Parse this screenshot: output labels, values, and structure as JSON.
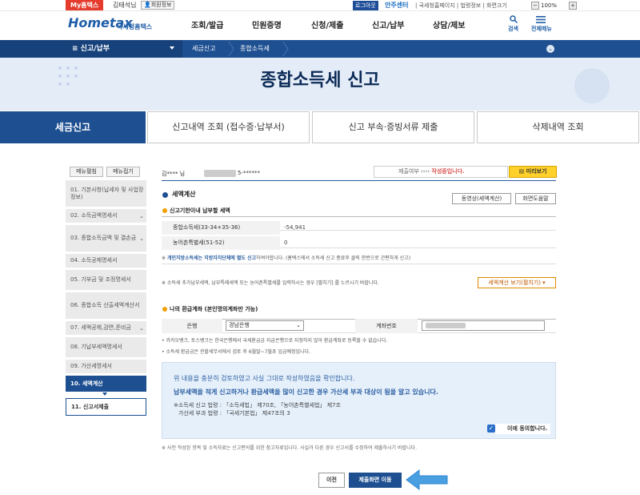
{
  "topbar": {
    "my_hometax": "My홈택스",
    "user_name": "김태석님",
    "user_info": "회원정보",
    "logout": "로그아웃",
    "safe_center": "안주센터",
    "links": "| 국세청홈페이지 | 법령정보 | 화면크기",
    "zoom_minus": "−",
    "zoom": "100%",
    "zoom_plus": "+"
  },
  "header": {
    "logo": "Hometax",
    "logo_sub": "국세청홈택스",
    "gnb": [
      "조회/발급",
      "민원증명",
      "신청/제출",
      "신고/납부",
      "상담/제보"
    ],
    "search": "검색",
    "all_menu": "전체메뉴"
  },
  "nav": {
    "title": "≡  신고/납부",
    "breadcrumb": [
      "세금신고",
      "종합소득세"
    ]
  },
  "banner": {
    "title": "종합소득세 신고"
  },
  "tabs": [
    "세금신고",
    "신고내역 조회 (접수증·납부서)",
    "신고 부속·증빙서류 제출",
    "삭제내역 조회"
  ],
  "sidebar": {
    "expand": "메뉴펼침",
    "collapse": "메뉴접기",
    "items": [
      "01. 기본사항(납세자 및 사업장정보)",
      "02. 소득금액명세서",
      "03. 종합소득금액 및 결손금",
      "04. 소득공제명세서",
      "05. 기부금 및 조정명세서",
      "06. 종합소득 산출세액계산서",
      "07. 세액공제,감면,준비금",
      "08. 기납부세액명세서",
      "09. 가산세명세서",
      "10. 세액계산",
      "11. 신고서제출"
    ]
  },
  "main": {
    "user_prefix": "김**** 님",
    "user_id_suffix": "5-******",
    "status_label": "제출여부 ›››› ",
    "status_value": "작성중입니다.",
    "preview": "미리보기",
    "section1_title": "세액계산",
    "video_btn": "동영상(세액계산)",
    "help_btn": "화면도움말",
    "sub1_title": "신고기한이내 납부할 세액",
    "rows": [
      {
        "label": "종합소득세(33-34+35-36)",
        "value": "-54,941"
      },
      {
        "label": "농어촌특별세(51-52)",
        "value": "0"
      }
    ],
    "note1_bold": "개인지방소득세는 지방자치단체에 별도 신고",
    "note1_rest": "하여야합니다. (홈택스에서 소득세 신고 종료후 클릭 한번으로 간편하게 신고)",
    "note2": "소득세 추가납부세액, 납부특례세액 또는 농어촌특별세를 입력하시는 경우 [펼치기] 를 누르시기 바랍니다.",
    "expand_btn": "세액계산 보기(펼치기) ▾",
    "section2_title": "나의 환급계좌 (본인명의계좌만 가능)",
    "bank_label": "은행",
    "bank_value": "경남은행",
    "account_label": "계좌번호",
    "bank_note1": "• 카카오뱅크, 토스뱅크는 한국은행에서 국세환급금 지급은행으로 지정하지 않아 환급계좌로 등록할 수 없습니다.",
    "bank_note2": "• 소득세 환급금은 관할세무서에서 검토 후 6월말~7월초 입금예정입니다.",
    "agree_line1": "위 내용을 충분히 검토하였고 사실 그대로 작성하였음을 확인합니다.",
    "agree_line2": "납부세액을 적게 신고하거나 환급세액을 많이 신고한 경우 가산세 부과 대상이 됨을 알고 있습니다.",
    "law_line1": "※소득세 신고 법령 : 「소득세법」 제70조, 「농어촌특별세법」 제7조",
    "law_line2": "가산세 부과 법령 : 「국세기본법」 제47조의 3",
    "agree_check": "✓",
    "agree_label": "이에 동의합니다.",
    "footnote": "※ 사전 작성된 항목 및 소득자료는 신고편의를 위한 참고자료입니다. 사실과 다른 경우 신고서를 수정하여 제출하시기 바랍니다.",
    "prev_btn": "이전",
    "submit_btn": "제출화면 이동"
  },
  "colors": {
    "brand": "#1d4f91",
    "accent": "#ffd12a",
    "red": "#e53b2c",
    "arrow": "#4a9fe0"
  }
}
